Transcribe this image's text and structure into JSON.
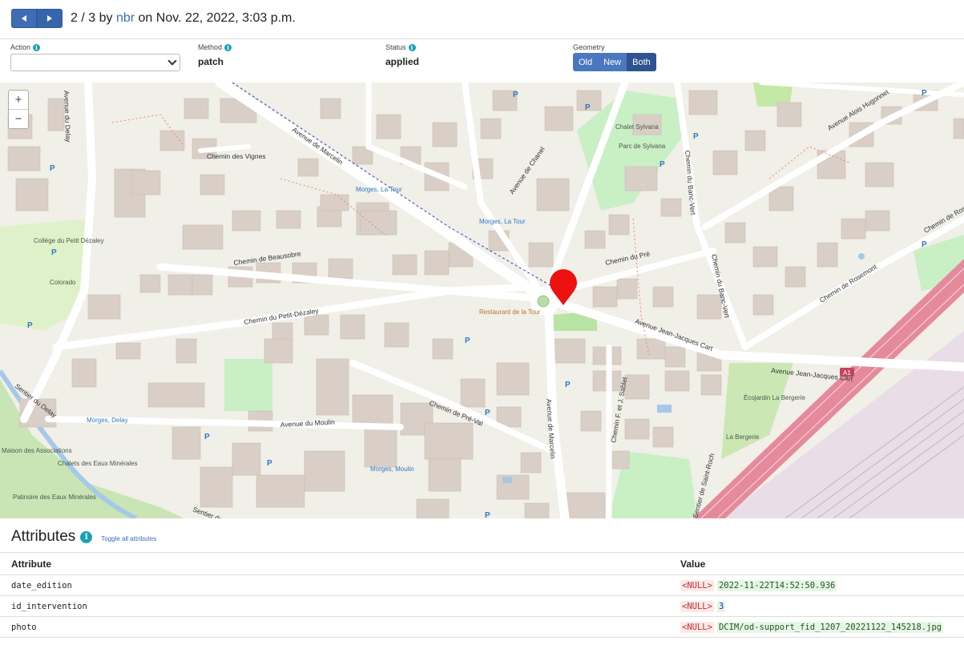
{
  "header": {
    "position": "2 / 3",
    "by_text": "by",
    "author": "nbr",
    "on_text": "on",
    "date": "Nov. 22, 2022, 3:03 p.m."
  },
  "form": {
    "action": {
      "label": "Action",
      "value": ""
    },
    "method": {
      "label": "Method",
      "value": "patch"
    },
    "status": {
      "label": "Status",
      "value": "applied"
    },
    "geometry": {
      "label": "Geometry",
      "options": [
        "Old",
        "New",
        "Both"
      ],
      "selected": "Both"
    }
  },
  "map": {
    "zoom_in": "+",
    "zoom_out": "−",
    "streets": [
      "Avenue de Marcelin",
      "Avenue du Delay",
      "Chemin des Vignes",
      "Avenue de Chanel",
      "Chemin du Banc-Vert",
      "Avenue Alois Hugonnet",
      "Chemin de Beausobre",
      "Chemin du Pré",
      "Chemin du Petit-Dézaley",
      "Avenue Jean-Jacques Cart",
      "Chemin de Rosemont",
      "Chemin de Pré-Val",
      "Avenue du Moulin",
      "Chemin F. et J. Sablet",
      "Sentier du Delay",
      "Sentier de Saint-Roch",
      "Sentier du Moulin"
    ],
    "pois": [
      "Collège du Petit Dézaley",
      "Chalet Sylvana",
      "Parc de Sylvana",
      "Morges, La Tour",
      "Restaurant de la Tour",
      "Morges, Delay",
      "Morges, Moulin",
      "Écojardin La Bergerie",
      "La Bergerie",
      "Maison des Associations",
      "Chalets des Eaux Minérales",
      "Patinoire des Eaux Minérales",
      "Colorado",
      "A1"
    ],
    "marker_color": "#ee1111"
  },
  "attributes": {
    "title": "Attributes",
    "toggle_label": "Toggle all attributes",
    "columns": [
      "Attribute",
      "Value"
    ],
    "null_label": "<NULL>",
    "rows": [
      {
        "name": "date_edition",
        "value": "2022-11-22T14:52:50.936"
      },
      {
        "name": "id_intervention",
        "value": "3"
      },
      {
        "name": "photo",
        "value": "DCIM/od-support_fid_1207_20221122_145218.jpg"
      }
    ]
  }
}
